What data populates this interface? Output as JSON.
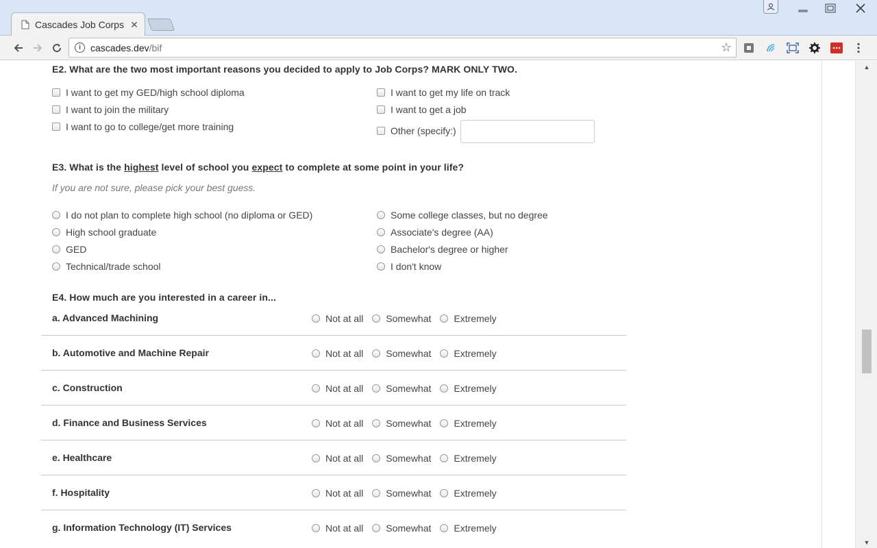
{
  "browser": {
    "tab_title": "Cascades Job Corps",
    "url_host": "cascades.dev",
    "url_path": "/bif",
    "win_minimize": "—",
    "win_maximize": "☐",
    "win_close": "✕"
  },
  "e2": {
    "question": "E2. What are the two most important reasons you decided to apply to Job Corps? MARK ONLY TWO.",
    "left_options": [
      "I want to get my GED/high school diploma",
      "I want to join the military",
      "I want to go to college/get more training"
    ],
    "right_options": [
      "I want to get my life on track",
      "I want to get a job",
      "Other (specify:)"
    ],
    "other_value": ""
  },
  "e3": {
    "q_prefix": "E3. What is the ",
    "q_emph1": "highest",
    "q_mid": " level of school you ",
    "q_emph2": "expect",
    "q_suffix": " to complete at some point in your life?",
    "hint": "If you are not sure, please pick your best guess.",
    "left_options": [
      "I do not plan to complete high school (no diploma or GED)",
      "High school graduate",
      "GED",
      "Technical/trade school"
    ],
    "right_options": [
      "Some college classes, but no degree",
      "Associate's degree (AA)",
      "Bachelor's degree or higher",
      "I don't know"
    ]
  },
  "e4": {
    "question": "E4. How much are you interested in a career in...",
    "scale": [
      "Not at all",
      "Somewhat",
      "Extremely"
    ],
    "careers": [
      "a. Advanced Machining",
      "b. Automotive and Machine Repair",
      "c. Construction",
      "d. Finance and Business Services",
      "e. Healthcare",
      "f. Hospitality",
      "g. Information Technology (IT) Services"
    ]
  }
}
